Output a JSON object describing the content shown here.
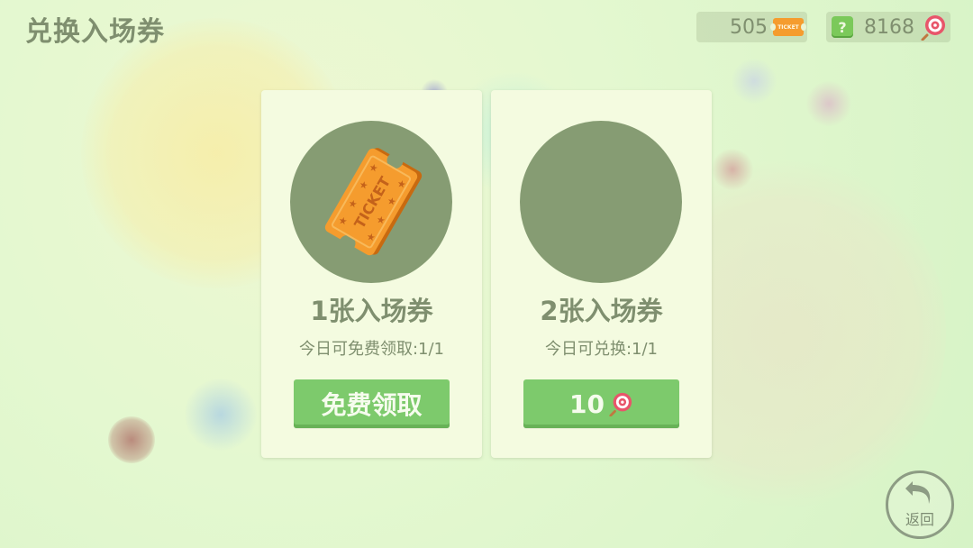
{
  "page": {
    "title": "兑换入场券"
  },
  "resources": {
    "tickets": {
      "value": "505",
      "icon": "ticket-icon",
      "icon_text": "TICKET"
    },
    "candies": {
      "value": "8168",
      "icon": "lollipop-icon",
      "add_icon": "plus-icon",
      "add_label": "?"
    }
  },
  "cards": [
    {
      "title": "1张入场券",
      "subtitle": "今日可免费领取:1/1",
      "image": "ticket-icon",
      "image_text": "TICKET",
      "button": {
        "label": "免费领取"
      }
    },
    {
      "title": "2张入场券",
      "subtitle": "今日可兑换:1/1",
      "image": "",
      "button": {
        "price": "10",
        "icon": "lollipop-icon"
      }
    }
  ],
  "back": {
    "label": "返回",
    "icon": "return-arrow-icon"
  },
  "colors": {
    "card_bg": "#f4fbe0",
    "circle": "#869c73",
    "button": "#7dca6c",
    "text": "#7f8f6f",
    "ticket": "#f59c2e"
  }
}
